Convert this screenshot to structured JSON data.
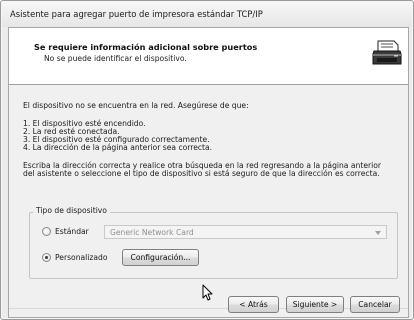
{
  "window": {
    "title": "Asistente para agregar puerto de impresora estándar TCP/IP"
  },
  "header": {
    "title": "Se requiere información adicional sobre puertos",
    "subtitle": "No se puede identificar el dispositivo.",
    "icon": "printer-network-icon"
  },
  "body": {
    "intro": "El dispositivo no se encuentra en la red. Asegúrese de que:",
    "checklist": [
      "1.  El dispositivo esté encendido.",
      "2.  La red esté conectada.",
      "3.  El dispositivo esté configurado correctamente.",
      "4.  La dirección de la página anterior sea correcta."
    ],
    "instructions_line1": "Escriba la dirección correcta y realice otra búsqueda en la red regresando a la página anterior",
    "instructions_line2": "del asistente o seleccione el tipo de dispositivo si está seguro de que la dirección es correcta."
  },
  "device_type": {
    "group_label": "Tipo de dispositivo",
    "standard_label": "Estándar",
    "standard_selected": false,
    "standard_value": "Generic Network Card",
    "custom_label": "Personalizado",
    "custom_selected": true,
    "config_button": "Configuración..."
  },
  "footer": {
    "back_button": "< Atrás",
    "next_button": "Siguiente >",
    "cancel_button": "Cancelar"
  }
}
